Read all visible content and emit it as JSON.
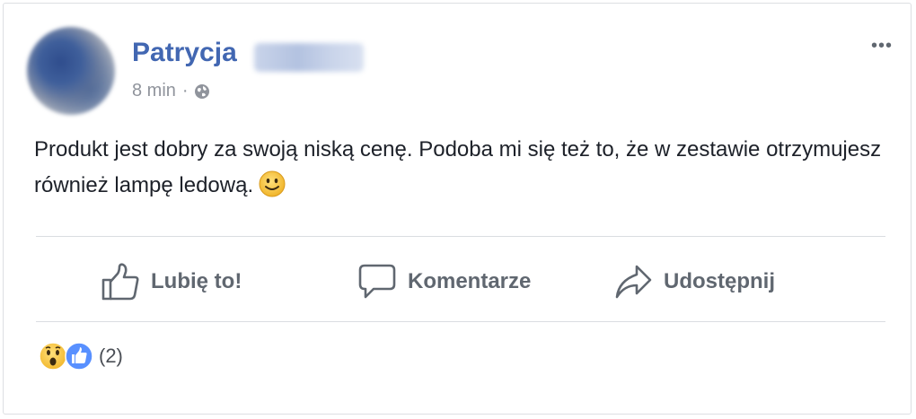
{
  "post": {
    "author_first_name": "Patrycja",
    "time": "8 min",
    "separator": "·",
    "privacy_icon": "globe-icon",
    "more_icon": "more-options-icon",
    "more_label": "•••",
    "text": "Produkt jest dobry za swoją niską cenę. Podoba mi się też to, że w zestawie otrzymujesz również lampę ledową.",
    "inline_emoji": "smile-emoji-icon"
  },
  "actions": {
    "like_label": "Lubię to!",
    "comment_label": "Komentarze",
    "share_label": "Udostępnij"
  },
  "reactions": {
    "icons": [
      "wow-reaction-icon",
      "like-reaction-icon"
    ],
    "count_label": "(2)"
  },
  "colors": {
    "author": "#4267b2",
    "meta": "#90949c",
    "body_text": "#1d2129",
    "action_text": "#606770",
    "like_blue": "#5890ff",
    "emoji_yellow": "#f7c94c"
  }
}
